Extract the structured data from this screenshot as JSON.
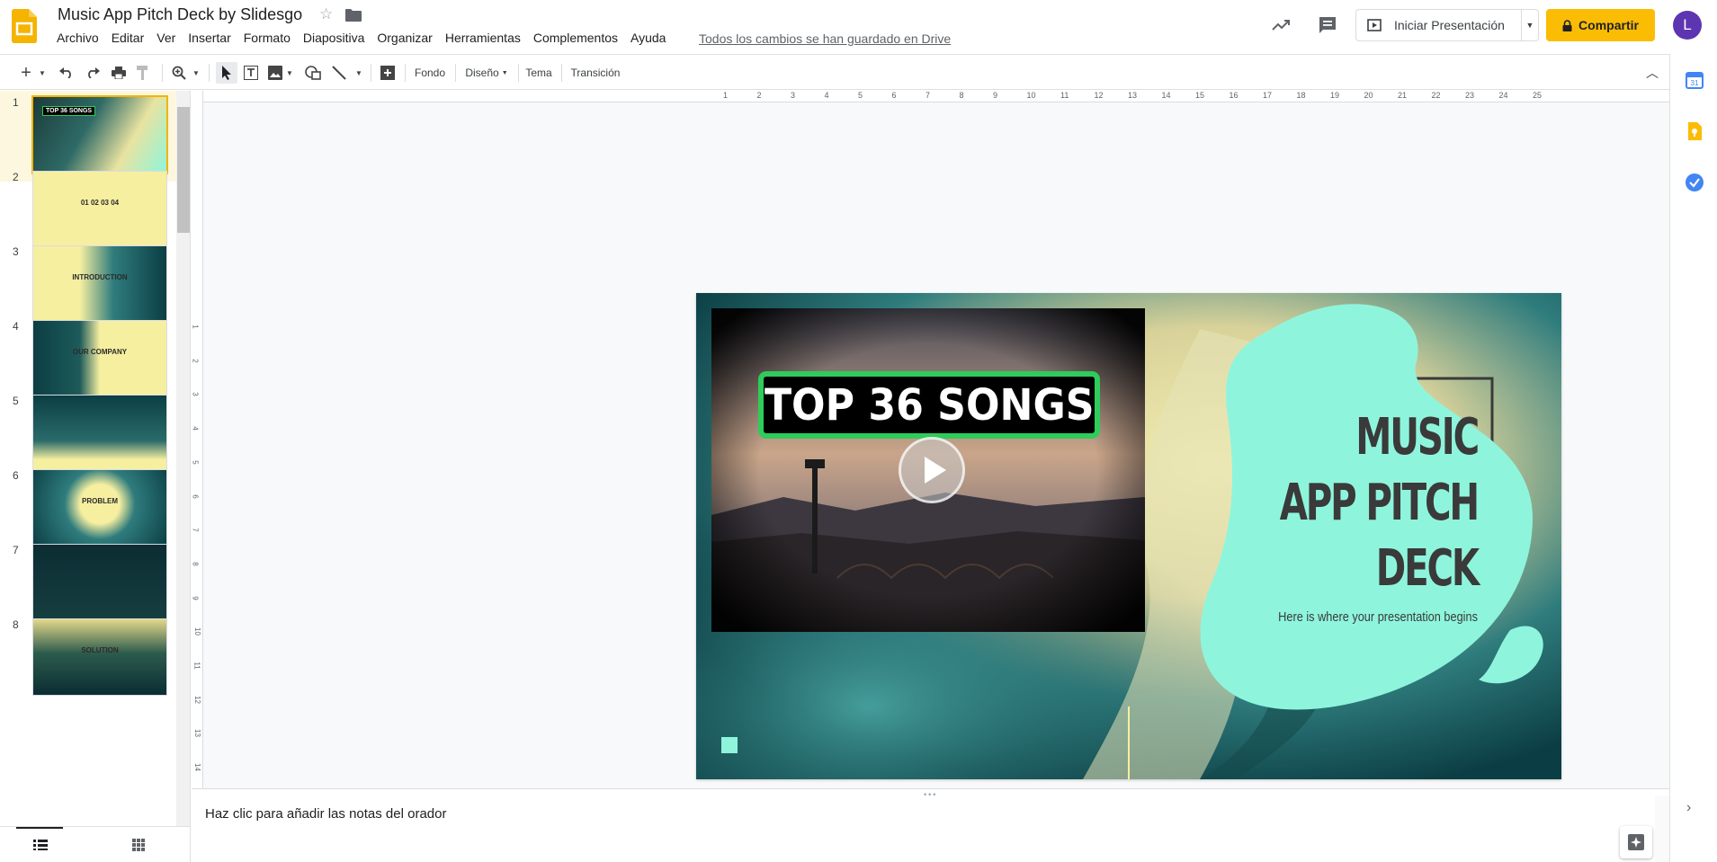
{
  "app": {
    "doc_title": "Music App Pitch Deck by Slidesgo",
    "save_status": "Todos los cambios se han guardado en Drive",
    "avatar_initial": "L"
  },
  "menu": [
    "Archivo",
    "Editar",
    "Ver",
    "Insertar",
    "Formato",
    "Diapositiva",
    "Organizar",
    "Herramientas",
    "Complementos",
    "Ayuda"
  ],
  "header_actions": {
    "present_label": "Iniciar Presentación",
    "share_label": "Compartir"
  },
  "toolbar": {
    "background_label": "Fondo",
    "layout_label": "Diseño",
    "theme_label": "Tema",
    "transition_label": "Transición"
  },
  "filmstrip": {
    "active_slide": 1,
    "slides": [
      {
        "number": "1",
        "thumb_text": "TOP 36 SONGS"
      },
      {
        "number": "2",
        "thumb_text": "01 02 03 04"
      },
      {
        "number": "3",
        "thumb_text": "INTRODUCTION"
      },
      {
        "number": "4",
        "thumb_text": "OUR COMPANY"
      },
      {
        "number": "5",
        "thumb_text": ""
      },
      {
        "number": "6",
        "thumb_text": "PROBLEM"
      },
      {
        "number": "7",
        "thumb_text": ""
      },
      {
        "number": "8",
        "thumb_text": "SOLUTION"
      }
    ]
  },
  "ruler": {
    "h_ticks": [
      "1",
      "2",
      "3",
      "4",
      "5",
      "6",
      "7",
      "8",
      "9",
      "10",
      "11",
      "12",
      "13",
      "14",
      "15",
      "16",
      "17",
      "18",
      "19",
      "20",
      "21",
      "22",
      "23",
      "24",
      "25"
    ],
    "v_ticks": [
      "1",
      "2",
      "3",
      "4",
      "5",
      "6",
      "7",
      "8",
      "9",
      "10",
      "11",
      "12",
      "13",
      "14"
    ]
  },
  "slide": {
    "title": "MUSIC APP PITCH DECK",
    "title_lines": [
      "MUSIC",
      "APP PITCH",
      "DECK"
    ],
    "subtitle": "Here is where your presentation begins",
    "video_banner": "TOP 36 SONGS"
  },
  "notes": {
    "placeholder": "Haz clic para añadir las notas del orador"
  },
  "colors": {
    "accent_yellow": "#fbbc04",
    "slide_mint": "#8ef5dc",
    "slide_yellow": "#f6efa0",
    "video_border_green": "#2ecc5a",
    "avatar_purple": "#5e35b1"
  }
}
